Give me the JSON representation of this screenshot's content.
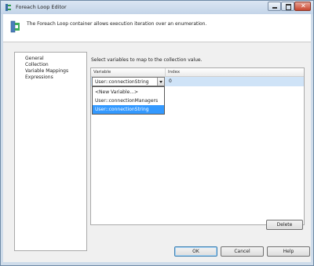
{
  "window": {
    "title": "Foreach Loop Editor"
  },
  "header": {
    "description": "The Foreach Loop container allows execution iteration over an enumeration."
  },
  "nav": {
    "items": [
      "General",
      "Collection",
      "Variable Mappings",
      "Expressions"
    ]
  },
  "main": {
    "instructions": "Select variables to map to the collection value.",
    "columns": [
      "Variable",
      "Index"
    ],
    "row": {
      "variable": "User::connectionString",
      "index": "0"
    },
    "dropdown_options": [
      "<New Variable...>",
      "User::connectionManagers",
      "User::connectionString"
    ],
    "selected_option": "User::connectionString"
  },
  "buttons": {
    "delete": "Delete",
    "ok": "OK",
    "cancel": "Cancel",
    "help": "Help"
  },
  "colors": {
    "selection": "#3399ff",
    "row_highlight": "#cfe3f7",
    "window_frame": "#cfdcea"
  }
}
